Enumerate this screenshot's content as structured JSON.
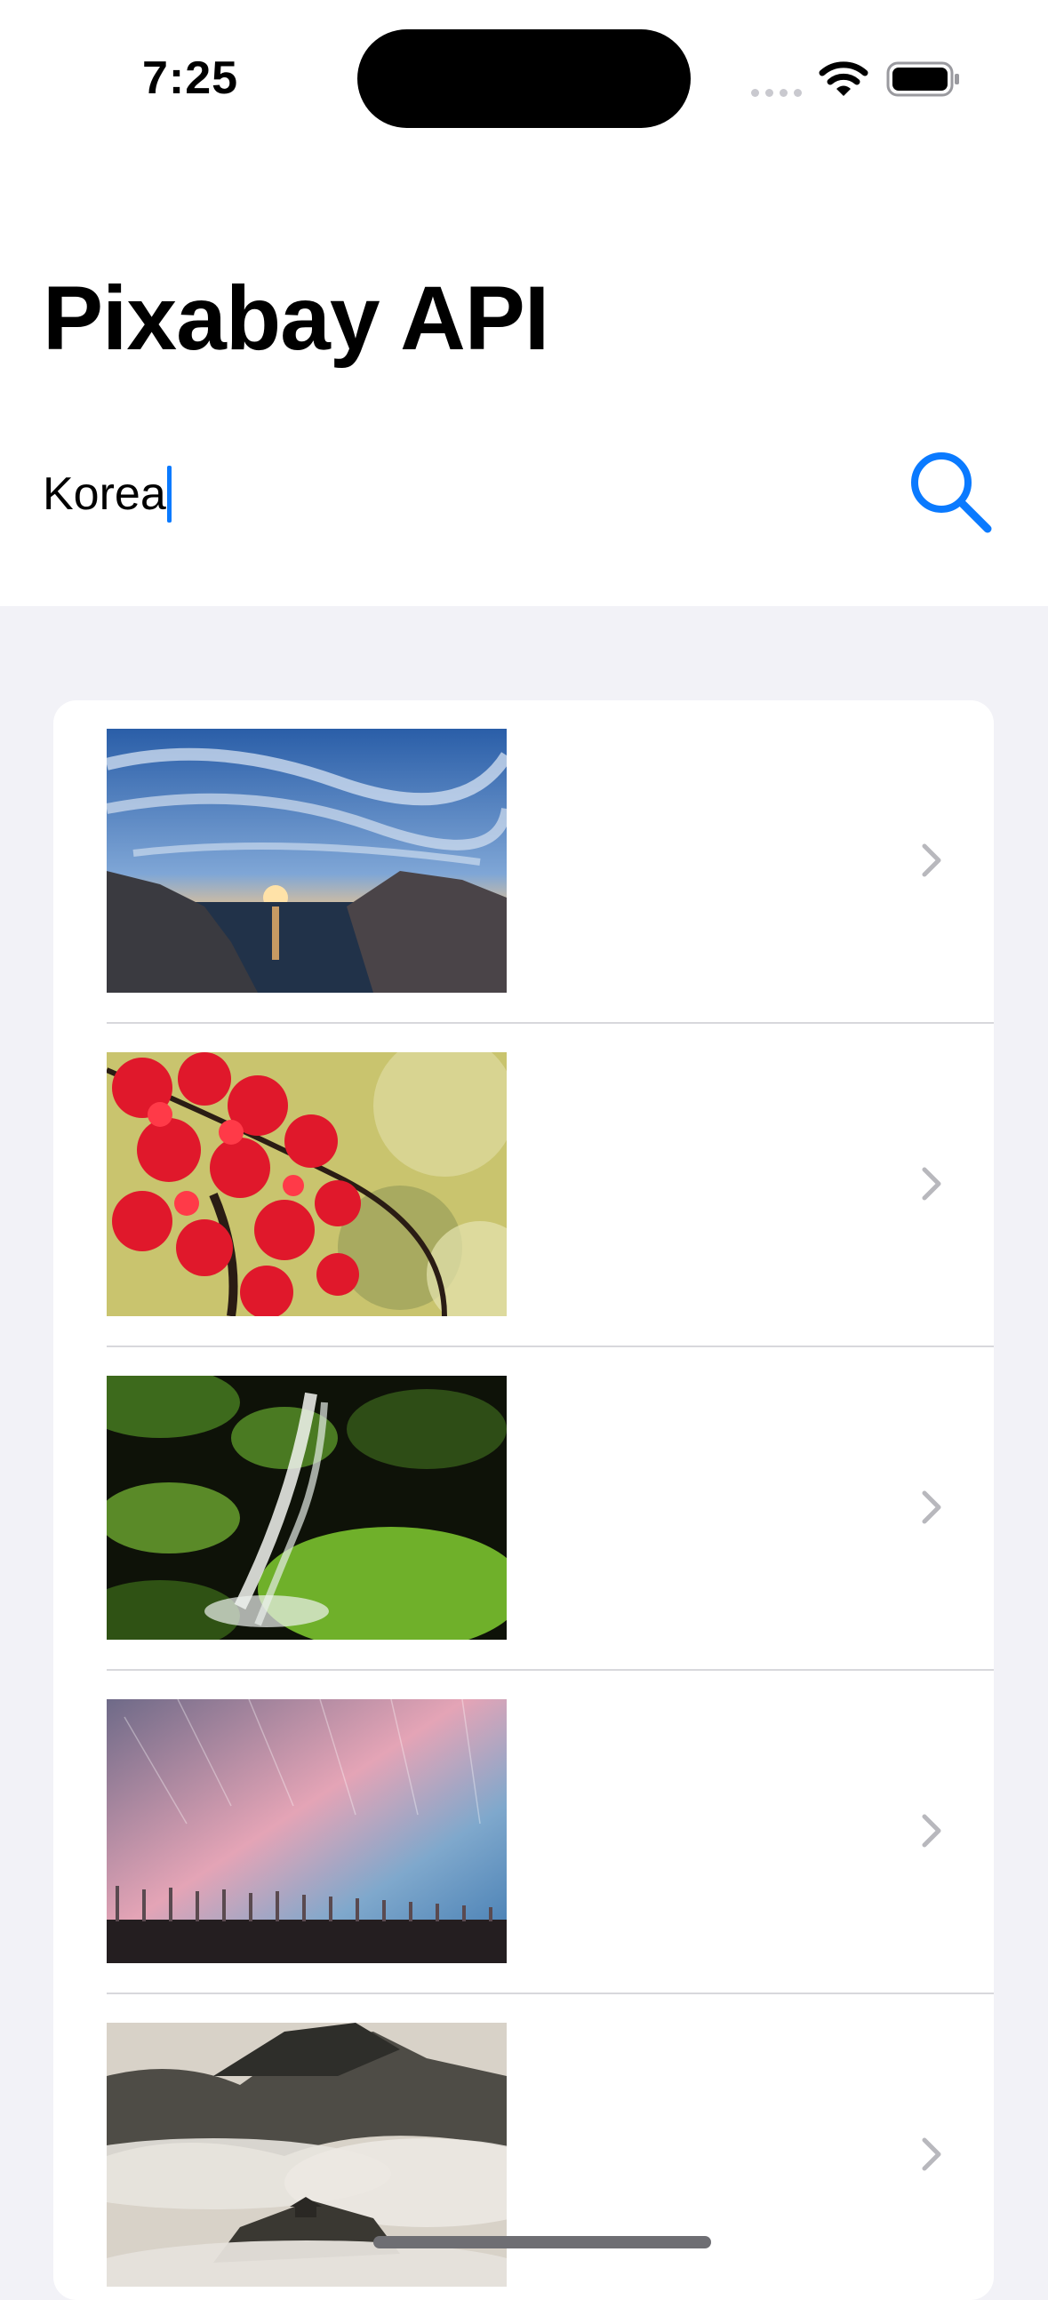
{
  "status_bar": {
    "time": "7:25",
    "icons": [
      "cellular-signal-icon",
      "wifi-icon",
      "battery-icon"
    ]
  },
  "header": {
    "title": "Pixabay API"
  },
  "search": {
    "value": "Korea",
    "button_icon": "magnifying-glass-icon"
  },
  "results": [
    {
      "thumbnail": "sunset over rocky coastline with clouds",
      "accessory": "chevron-right-icon"
    },
    {
      "thumbnail": "red maple leaves on branch",
      "accessory": "chevron-right-icon"
    },
    {
      "thumbnail": "waterfall over mossy rocks",
      "accessory": "chevron-right-icon"
    },
    {
      "thumbnail": "star trails over tree line at dusk",
      "accessory": "chevron-right-icon"
    },
    {
      "thumbnail": "misty mountain with pavilion",
      "accessory": "chevron-right-icon"
    }
  ],
  "colors": {
    "accent": "#0a7aff",
    "grouped_background": "#f2f2f7",
    "chevron": "#b8b8bd"
  }
}
